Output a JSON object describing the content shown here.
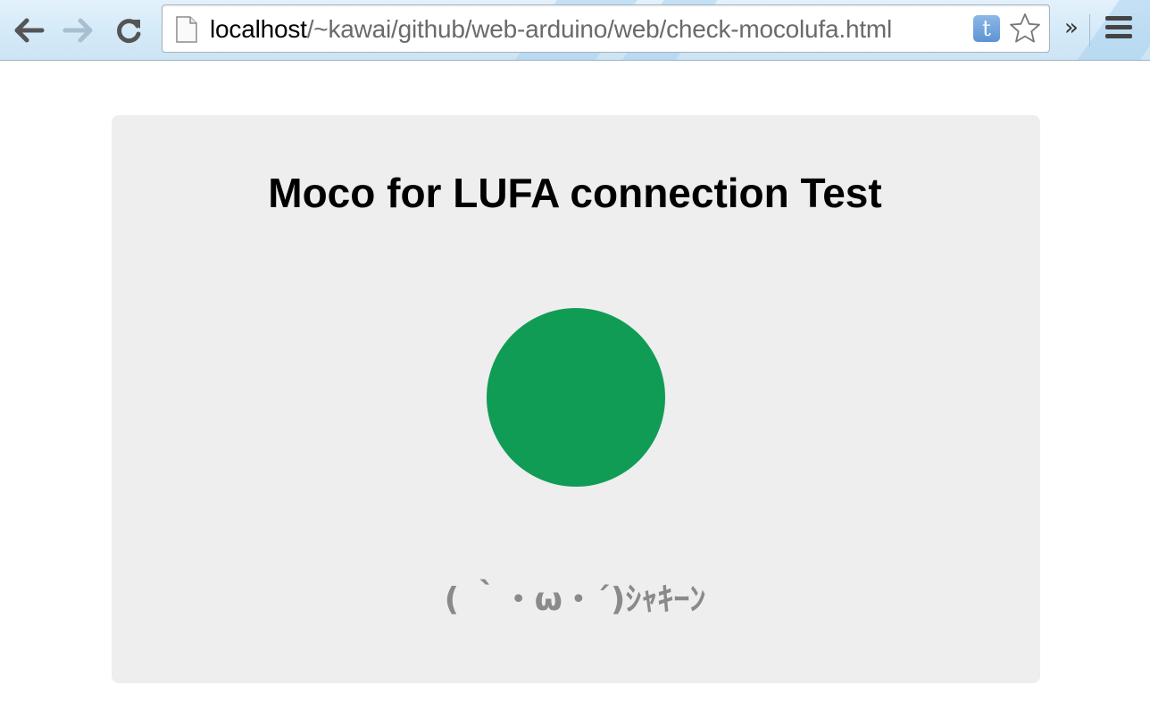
{
  "browser": {
    "url_host": "localhost",
    "url_path": "/~kawai/github/web-arduino/web/check-mocolufa.html",
    "extension_label": "t",
    "overflow_label": "»",
    "icons": {
      "back": "back-arrow-icon",
      "forward": "forward-arrow-icon",
      "reload": "reload-icon",
      "page": "page-icon",
      "bookmark": "star-icon",
      "menu": "menu-icon"
    }
  },
  "page": {
    "title": "Moco for LUFA connection Test",
    "status_text": "( ｀・ω・´)ｼｬｷｰﾝ",
    "led_state": "connected",
    "colors": {
      "led": "#109c55",
      "card_bg": "#eeeeee",
      "status_text": "#8a8a8a"
    }
  }
}
